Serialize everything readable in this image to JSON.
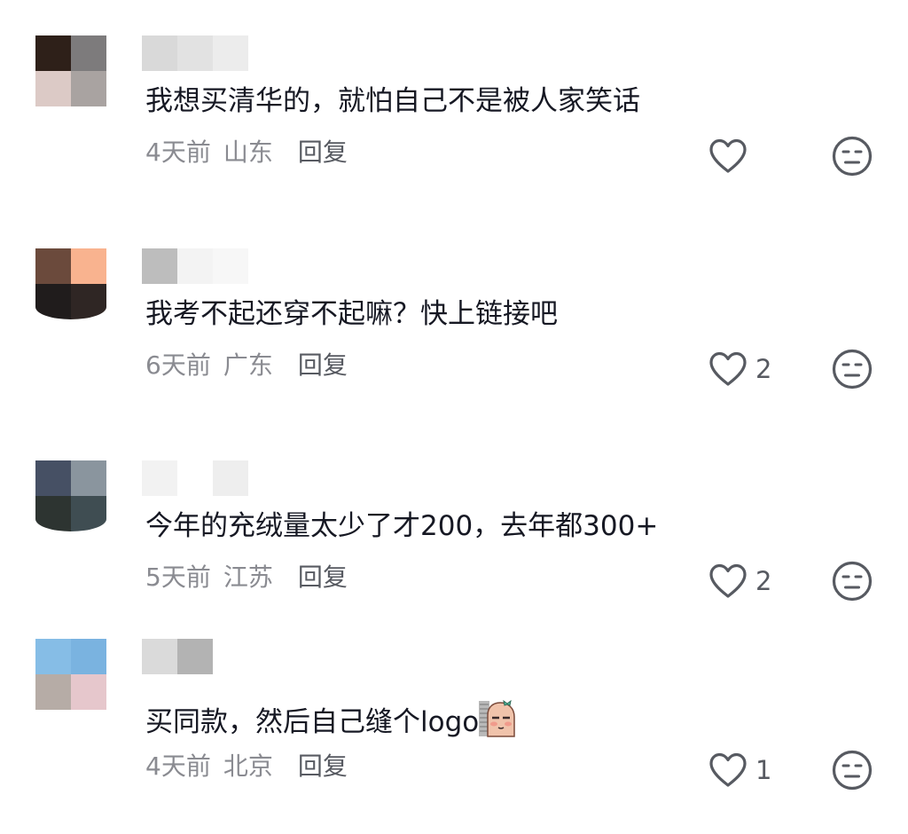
{
  "comments": [
    {
      "text": "我想买清华的，就怕自己不是被人家笑话",
      "time": "4天前",
      "location": "山东",
      "reply_label": "回复",
      "likes": "",
      "avatar_colors": [
        "#2e2019",
        "#7d7b7c",
        "#dccac6",
        "#a9a3a1"
      ],
      "name_colors": [
        "#d9d9d9",
        "#e2e2e2",
        "#ececec"
      ]
    },
    {
      "text": "我考不起还穿不起嘛？快上链接吧",
      "time": "6天前",
      "location": "广东",
      "reply_label": "回复",
      "likes": "2",
      "avatar_colors": [
        "#6b4a3c",
        "#f9b38f",
        "#201c1c",
        "#2f2624"
      ],
      "name_colors": [
        "#bdbdbd",
        "#f3f3f3",
        "#f7f7f7"
      ]
    },
    {
      "text": "今年的充绒量太少了才200，去年都300+",
      "time": "5天前",
      "location": "江苏",
      "reply_label": "回复",
      "likes": "2",
      "avatar_colors": [
        "#465064",
        "#8a959e",
        "#2d3431",
        "#3f4d52"
      ],
      "name_colors": [
        "#f2f2f2",
        "#ffffff",
        "#eeeeee"
      ]
    },
    {
      "text": "买同款，然后自己缝个logo",
      "time": "4天前",
      "location": "北京",
      "reply_label": "回复",
      "likes": "1",
      "avatar_colors": [
        "#86bde6",
        "#7ab3e0",
        "#b6aca6",
        "#e6c7cc"
      ],
      "name_colors": [
        "#dadada",
        "#b3b3b3",
        "#ffffff"
      ]
    }
  ],
  "icons": {
    "like": "heart-outline-icon",
    "dislike": "neutral-face-icon",
    "emoji": "peeking-sausage-emoji"
  },
  "colors": {
    "text": "#161823",
    "meta": "#8a8b91",
    "icon": "#575a61"
  }
}
